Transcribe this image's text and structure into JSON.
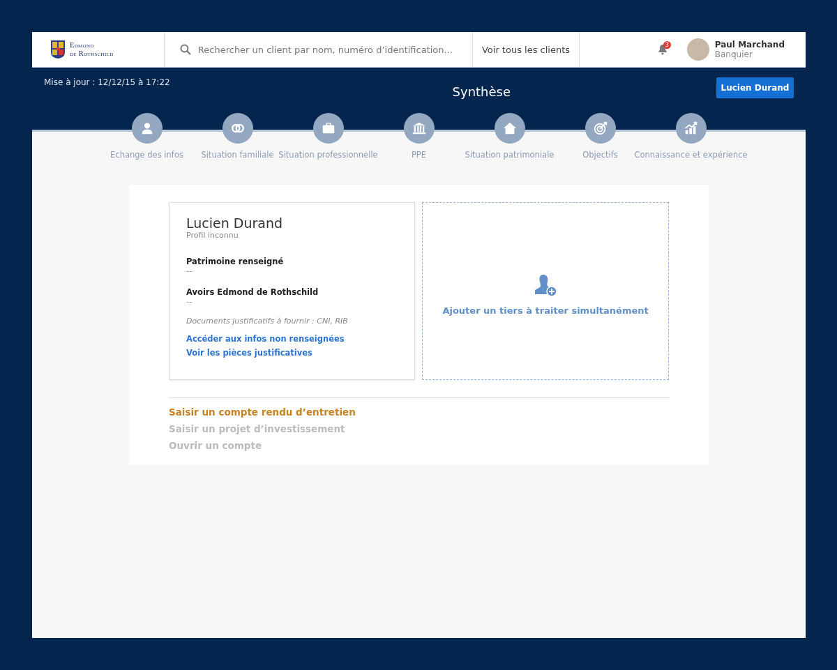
{
  "header": {
    "logo": {
      "line_1": "Edmond",
      "line_2": "de Rothschild"
    },
    "search": {
      "placeholder": "Rechercher un client par nom, numéro d’identification..."
    },
    "all_clients_link": "Voir tous les clients",
    "notifications": {
      "count": "3"
    },
    "user": {
      "name": "Paul Marchand",
      "role": "Banquier"
    }
  },
  "banner": {
    "updated": "Mise à jour : 12/12/15 à 17:22",
    "title": "Synthèse",
    "client_button": "Lucien Durand"
  },
  "steps": [
    {
      "label": "Echange des infos"
    },
    {
      "label": "Situation familiale"
    },
    {
      "label": "Situation professionnelle"
    },
    {
      "label": "PPE"
    },
    {
      "label": "Situation patrimoniale"
    },
    {
      "label": "Objectifs"
    },
    {
      "label": "Connaissance et expérience"
    }
  ],
  "client_card": {
    "name": "Lucien Durand",
    "profile": "Profil inconnu",
    "fields": [
      {
        "label": "Patrimoine renseigné",
        "value": "--"
      },
      {
        "label": "Avoirs Edmond de Rothschild",
        "value": "--"
      }
    ],
    "documents_note": "Documents justificatifs à fournir : CNI, RIB",
    "links": [
      "Accéder aux infos non renseignées",
      "Voir les pièces justificatives"
    ]
  },
  "add_third_party": {
    "label": "Ajouter un tiers à traiter simultanément"
  },
  "actions": [
    {
      "label": "Saisir un compte rendu d’entretien",
      "disabled": false
    },
    {
      "label": "Saisir un projet d’investissement",
      "disabled": true
    },
    {
      "label": "Ouvrir un compte",
      "disabled": true
    }
  ]
}
